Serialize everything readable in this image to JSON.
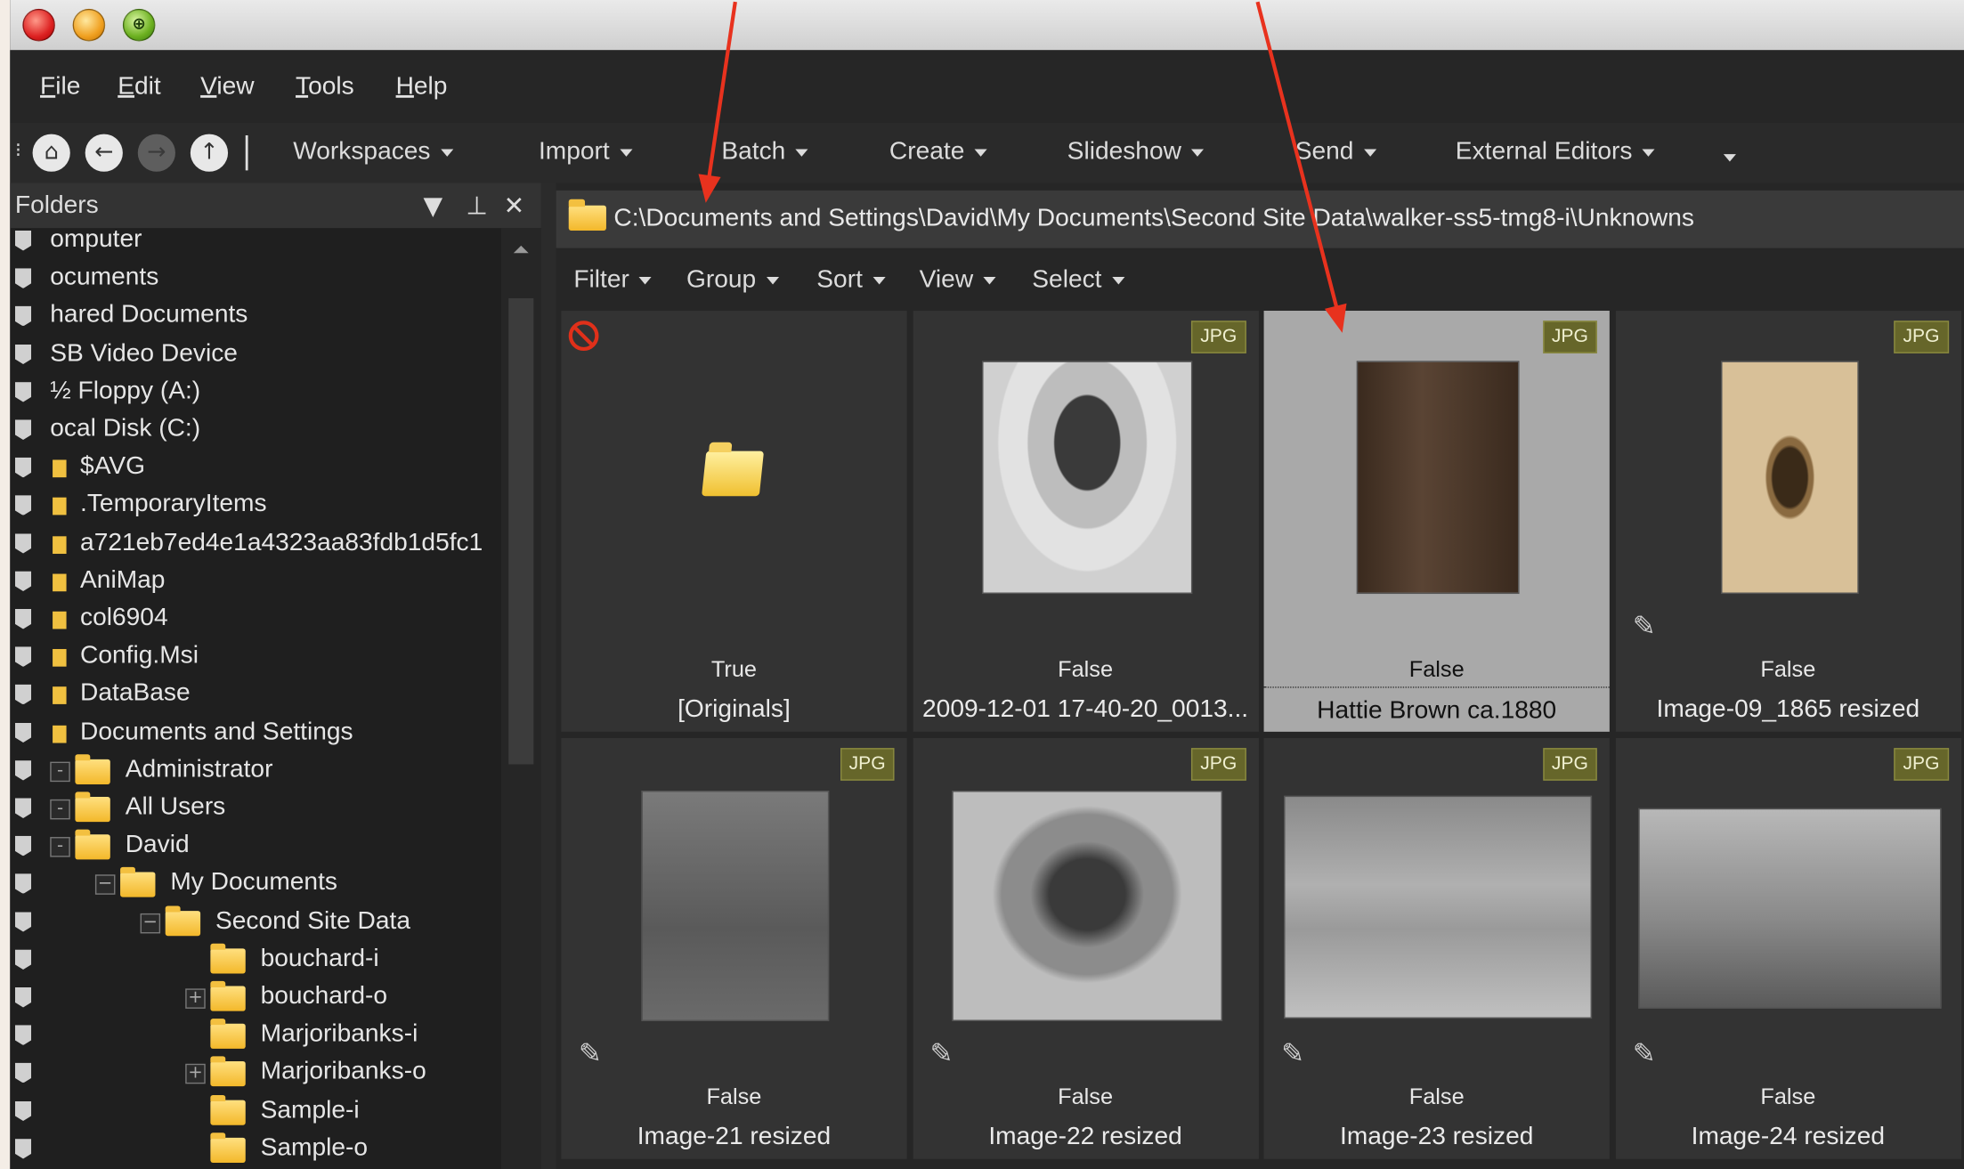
{
  "window": {
    "traffic_lights": [
      "close",
      "minimize",
      "zoom"
    ],
    "zoom_glyph": "⊕"
  },
  "menubar": [
    "File",
    "Edit",
    "View",
    "Tools",
    "Help"
  ],
  "toolbar": {
    "nav_icons": [
      "home-icon",
      "back-icon",
      "forward-icon",
      "up-icon"
    ],
    "menus": [
      "Workspaces",
      "Import",
      "Batch",
      "Create",
      "Slideshow",
      "Send",
      "External Editors"
    ]
  },
  "folders_pane": {
    "title": "Folders",
    "items": [
      {
        "label": "omputer",
        "type": "root"
      },
      {
        "label": "ocuments",
        "type": "root"
      },
      {
        "label": "hared Documents",
        "type": "root"
      },
      {
        "label": "SB Video Device",
        "type": "root"
      },
      {
        "label": "½ Floppy (A:)",
        "type": "root"
      },
      {
        "label": "ocal Disk (C:)",
        "type": "root"
      },
      {
        "label": "$AVG",
        "type": "small"
      },
      {
        "label": ".TemporaryItems",
        "type": "small"
      },
      {
        "label": "a721eb7ed4e1a4323aa83fdb1d5fc1",
        "type": "small"
      },
      {
        "label": "AniMap",
        "type": "small"
      },
      {
        "label": "col6904",
        "type": "small"
      },
      {
        "label": "Config.Msi",
        "type": "small"
      },
      {
        "label": "DataBase",
        "type": "small"
      },
      {
        "label": "Documents and Settings",
        "type": "small"
      },
      {
        "label": "Administrator",
        "type": "folder",
        "level": 1
      },
      {
        "label": "All Users",
        "type": "folder",
        "level": 1
      },
      {
        "label": "David",
        "type": "folder",
        "level": 1
      },
      {
        "label": "My Documents",
        "type": "folder",
        "level": 2
      },
      {
        "label": "Second Site Data",
        "type": "folder",
        "level": 3
      },
      {
        "label": "bouchard-i",
        "type": "folder",
        "level": 4
      },
      {
        "label": "bouchard-o",
        "type": "folder",
        "level": 4
      },
      {
        "label": "Marjoribanks-i",
        "type": "folder",
        "level": 4
      },
      {
        "label": "Marjoribanks-o",
        "type": "folder",
        "level": 4
      },
      {
        "label": "Sample-i",
        "type": "folder",
        "level": 4
      },
      {
        "label": "Sample-o",
        "type": "folder",
        "level": 4
      }
    ]
  },
  "path": "C:\\Documents and Settings\\David\\My Documents\\Second Site Data\\walker-ss5-tmg8-i\\Unknowns",
  "filterbar": [
    "Filter",
    "Group",
    "Sort",
    "View",
    "Select"
  ],
  "thumbnails": [
    {
      "name": "[Originals]",
      "flag": "True",
      "badge": "",
      "kind": "folder"
    },
    {
      "name": "2009-12-01 17-40-20_0013...",
      "flag": "False",
      "badge": "JPG",
      "kind": "photo"
    },
    {
      "name": "Hattie Brown ca.1880",
      "flag": "False",
      "badge": "JPG",
      "kind": "photo",
      "selected": true
    },
    {
      "name": "Image-09_1865 resized",
      "flag": "False",
      "badge": "JPG",
      "kind": "photo"
    },
    {
      "name": "Image-21 resized",
      "flag": "False",
      "badge": "JPG",
      "kind": "photo"
    },
    {
      "name": "Image-22 resized",
      "flag": "False",
      "badge": "JPG",
      "kind": "photo"
    },
    {
      "name": "Image-23 resized",
      "flag": "False",
      "badge": "JPG",
      "kind": "photo"
    },
    {
      "name": "Image-24 resized",
      "flag": "False",
      "badge": "JPG",
      "kind": "photo"
    }
  ],
  "colors": {
    "annotation_arrow": "#e8321e",
    "badge_bg": "#66662a",
    "selected_cell": "#a9a9a9"
  }
}
